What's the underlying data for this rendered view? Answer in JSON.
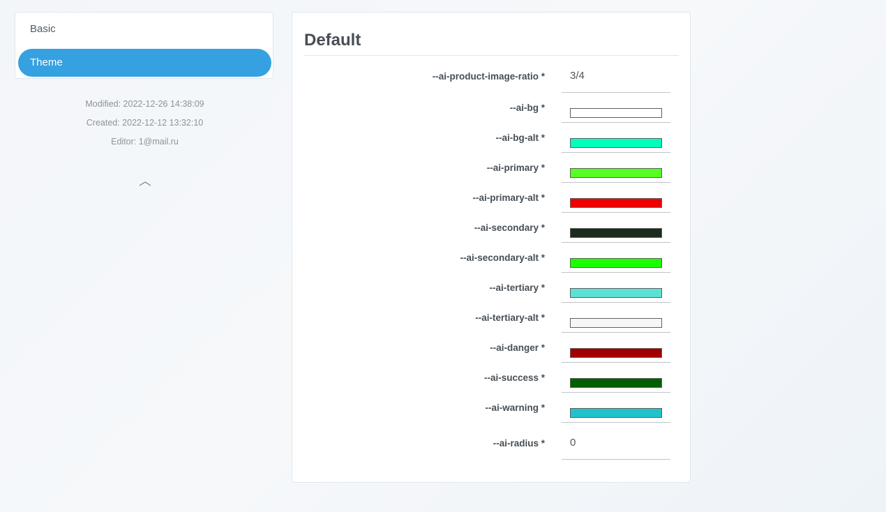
{
  "sidebar": {
    "items": [
      {
        "label": "Basic",
        "active": false
      },
      {
        "label": "Theme",
        "active": true
      }
    ],
    "modified": "Modified: 2022-12-26 14:38:09",
    "created": "Created: 2022-12-12 13:32:10",
    "editor": "Editor: 1@mail.ru",
    "collapse_icon": "chevron-up-icon"
  },
  "panel": {
    "title": "Default",
    "fields": [
      {
        "label": "--ai-product-image-ratio *",
        "type": "text",
        "value": "3/4"
      },
      {
        "label": "--ai-bg *",
        "type": "color",
        "value": "#ffffff"
      },
      {
        "label": "--ai-bg-alt *",
        "type": "color",
        "value": "#00ffbb"
      },
      {
        "label": "--ai-primary *",
        "type": "color",
        "value": "#55ff22"
      },
      {
        "label": "--ai-primary-alt *",
        "type": "color",
        "value": "#ee0000"
      },
      {
        "label": "--ai-secondary *",
        "type": "color",
        "value": "#1b2b1e"
      },
      {
        "label": "--ai-secondary-alt *",
        "type": "color",
        "value": "#1cff00"
      },
      {
        "label": "--ai-tertiary *",
        "type": "color",
        "value": "#5ce1d6"
      },
      {
        "label": "--ai-tertiary-alt *",
        "type": "color",
        "value": "#f6f6f6"
      },
      {
        "label": "--ai-danger *",
        "type": "color",
        "value": "#a20000"
      },
      {
        "label": "--ai-success *",
        "type": "color",
        "value": "#005f00"
      },
      {
        "label": "--ai-warning *",
        "type": "color",
        "value": "#22c2cc"
      },
      {
        "label": "--ai-radius *",
        "type": "text",
        "value": "0"
      }
    ]
  }
}
